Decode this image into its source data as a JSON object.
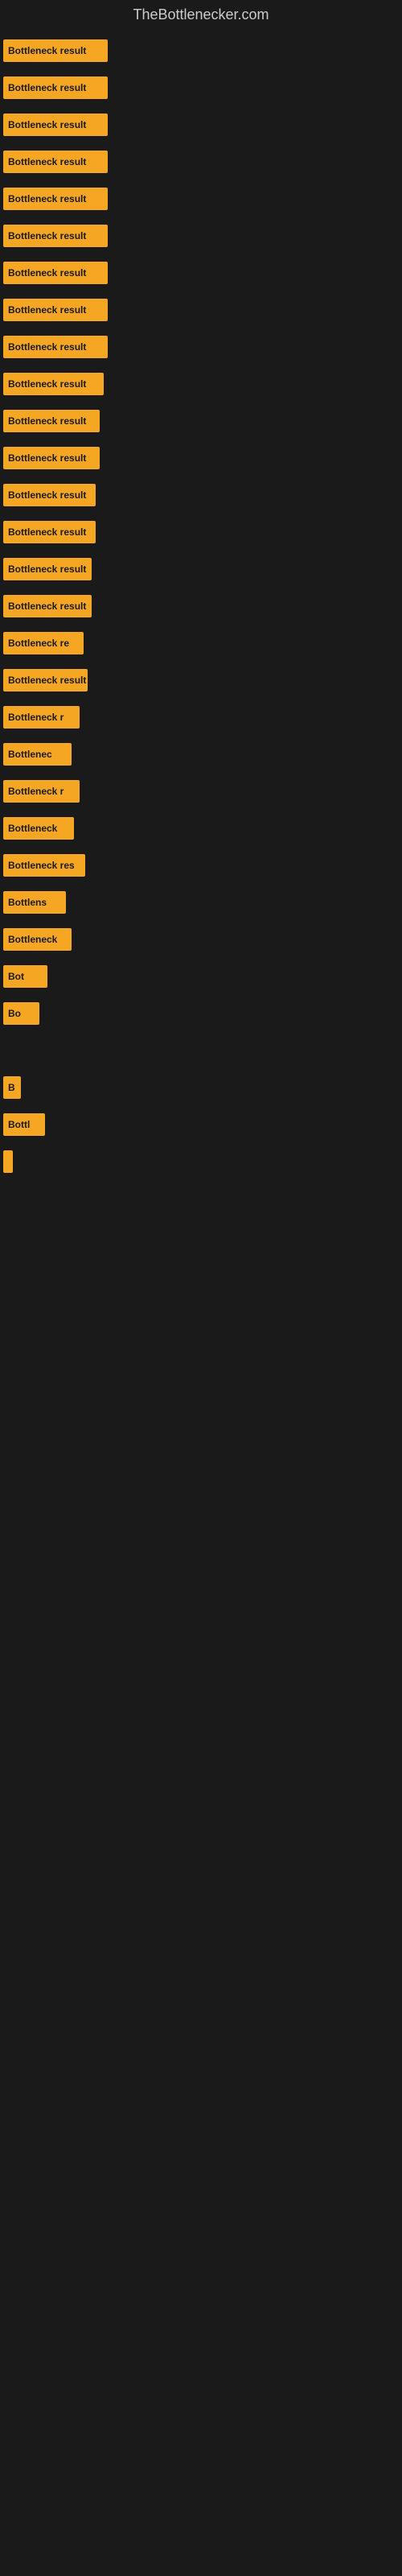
{
  "site": {
    "title": "TheBottlenecker.com"
  },
  "results": [
    {
      "label": "Bottleneck result",
      "width": 130,
      "truncated": false
    },
    {
      "label": "Bottleneck result",
      "width": 130,
      "truncated": false
    },
    {
      "label": "Bottleneck result",
      "width": 130,
      "truncated": false
    },
    {
      "label": "Bottleneck result",
      "width": 130,
      "truncated": false
    },
    {
      "label": "Bottleneck result",
      "width": 130,
      "truncated": false
    },
    {
      "label": "Bottleneck result",
      "width": 130,
      "truncated": false
    },
    {
      "label": "Bottleneck result",
      "width": 130,
      "truncated": false
    },
    {
      "label": "Bottleneck result",
      "width": 130,
      "truncated": false
    },
    {
      "label": "Bottleneck result",
      "width": 130,
      "truncated": false
    },
    {
      "label": "Bottleneck result",
      "width": 125,
      "truncated": false
    },
    {
      "label": "Bottleneck result",
      "width": 120,
      "truncated": false
    },
    {
      "label": "Bottleneck result",
      "width": 120,
      "truncated": false
    },
    {
      "label": "Bottleneck result",
      "width": 115,
      "truncated": false
    },
    {
      "label": "Bottleneck result",
      "width": 115,
      "truncated": false
    },
    {
      "label": "Bottleneck result",
      "width": 110,
      "truncated": false
    },
    {
      "label": "Bottleneck result",
      "width": 110,
      "truncated": false
    },
    {
      "label": "Bottleneck re",
      "width": 100,
      "truncated": true
    },
    {
      "label": "Bottleneck result",
      "width": 105,
      "truncated": false
    },
    {
      "label": "Bottleneck r",
      "width": 95,
      "truncated": true
    },
    {
      "label": "Bottlenec",
      "width": 85,
      "truncated": true
    },
    {
      "label": "Bottleneck r",
      "width": 95,
      "truncated": true
    },
    {
      "label": "Bottleneck",
      "width": 88,
      "truncated": true
    },
    {
      "label": "Bottleneck res",
      "width": 102,
      "truncated": true
    },
    {
      "label": "Bottlens",
      "width": 78,
      "truncated": true
    },
    {
      "label": "Bottleneck",
      "width": 85,
      "truncated": true
    },
    {
      "label": "Bot",
      "width": 55,
      "truncated": true
    },
    {
      "label": "Bo",
      "width": 45,
      "truncated": true
    },
    {
      "label": "",
      "width": 0,
      "truncated": false
    },
    {
      "label": "B",
      "width": 22,
      "truncated": true
    },
    {
      "label": "Bottl",
      "width": 52,
      "truncated": true
    },
    {
      "label": "",
      "width": 8,
      "truncated": false
    },
    {
      "label": "",
      "width": 0,
      "truncated": false
    },
    {
      "label": "",
      "width": 0,
      "truncated": false
    },
    {
      "label": "",
      "width": 0,
      "truncated": false
    },
    {
      "label": "",
      "width": 0,
      "truncated": false
    },
    {
      "label": "",
      "width": 0,
      "truncated": false
    },
    {
      "label": "",
      "width": 0,
      "truncated": false
    },
    {
      "label": "",
      "width": 0,
      "truncated": false
    },
    {
      "label": "",
      "width": 0,
      "truncated": false
    },
    {
      "label": "",
      "width": 0,
      "truncated": false
    }
  ]
}
